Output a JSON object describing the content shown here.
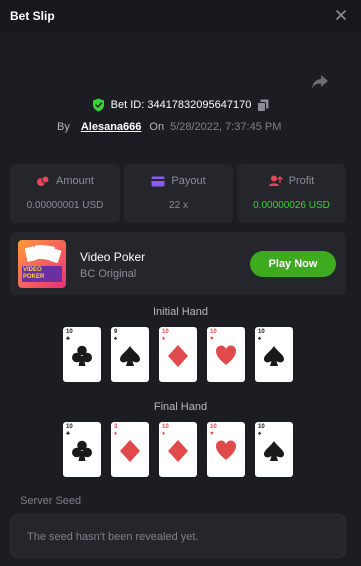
{
  "header": {
    "title": "Bet Slip"
  },
  "bet": {
    "id_text": "Bet ID: 344178320956471​70",
    "by_label": "By",
    "username": "Alesana666",
    "on_label": "On",
    "datetime": "5/28/2022, 7:37:45 PM"
  },
  "stats": [
    {
      "label": "Amount",
      "value": "0.00000001 USD",
      "icon": "coins-icon"
    },
    {
      "label": "Payout",
      "value": "22 x",
      "icon": "wallet-icon"
    },
    {
      "label": "Profit",
      "value": "0.00000026 USD",
      "icon": "profit-icon"
    }
  ],
  "game": {
    "name": "Video Poker",
    "provider": "BC Original",
    "play_label": "Play Now",
    "thumb_text": "VIDEO POKER"
  },
  "initial_hand": {
    "title": "Initial Hand",
    "cards": [
      {
        "rank": "10",
        "suit": "clubs",
        "color": "black"
      },
      {
        "rank": "9",
        "suit": "spades",
        "color": "black"
      },
      {
        "rank": "10",
        "suit": "diamonds",
        "color": "red"
      },
      {
        "rank": "10",
        "suit": "hearts",
        "color": "red"
      },
      {
        "rank": "10",
        "suit": "spades",
        "color": "black"
      }
    ]
  },
  "final_hand": {
    "title": "Final Hand",
    "cards": [
      {
        "rank": "10",
        "suit": "clubs",
        "color": "black"
      },
      {
        "rank": "3",
        "suit": "diamonds",
        "color": "red"
      },
      {
        "rank": "10",
        "suit": "diamonds",
        "color": "red"
      },
      {
        "rank": "10",
        "suit": "hearts",
        "color": "red"
      },
      {
        "rank": "10",
        "suit": "spades",
        "color": "black"
      }
    ]
  },
  "seed": {
    "label": "Server Seed",
    "placeholder": "The seed hasn't been revealed yet."
  },
  "colors": {
    "background": "#1c1d22",
    "card_bg": "#25262c",
    "accent_green": "#3eaa1f",
    "profit_green": "#3ad23a",
    "suit_red": "#e04a4a"
  }
}
